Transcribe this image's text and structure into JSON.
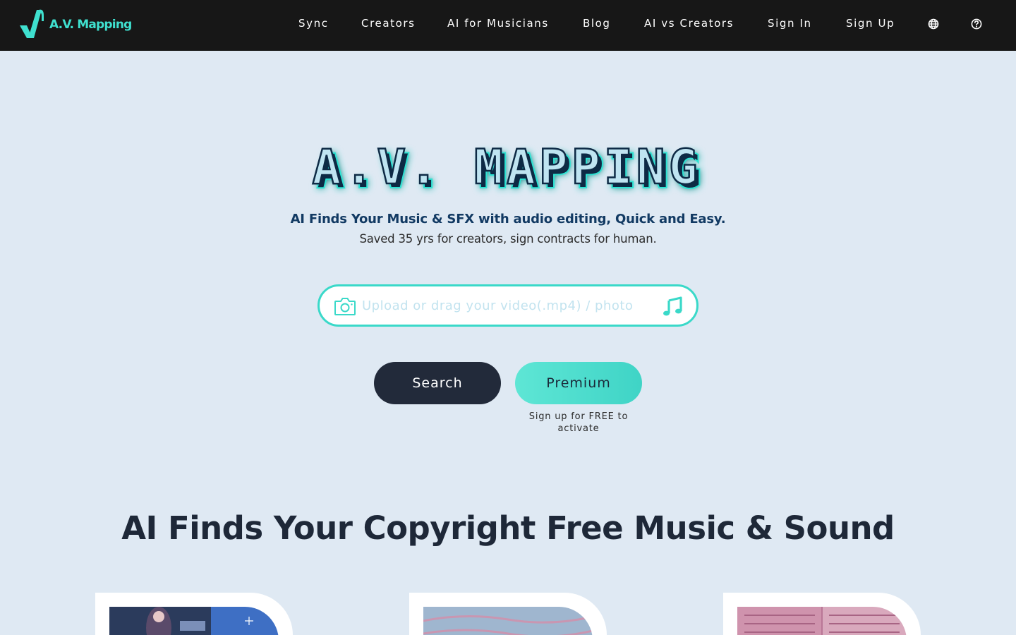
{
  "nav": {
    "logo_text": "A.V. Mapping",
    "links": [
      "Sync",
      "Creators",
      "AI for Musicians",
      "Blog",
      "AI vs Creators",
      "Sign In",
      "Sign Up"
    ],
    "language_icon": "globe-icon",
    "help_icon": "question-circle-icon"
  },
  "hero": {
    "title": "A.V. MAPPING",
    "tagline": "AI Finds Your Music & SFX with audio editing, Quick and Easy.",
    "subtagline": "Saved 35 yrs for creators, sign contracts for human."
  },
  "upload": {
    "placeholder": "Upload or drag your video(.mp4) / photo",
    "camera_icon": "camera-icon",
    "music_icon": "music-note-icon"
  },
  "buttons": {
    "search": "Search",
    "premium": "Premium",
    "premium_note": "Sign up for FREE to activate"
  },
  "section": {
    "title": "AI Finds Your Copyright Free Music & Sound"
  },
  "colors": {
    "accent": "#3ad9c9",
    "navbar_bg": "#171717",
    "page_bg": "#dfe9f3",
    "dark_button": "#222a3a",
    "title_stroke": "#0e2a45"
  }
}
